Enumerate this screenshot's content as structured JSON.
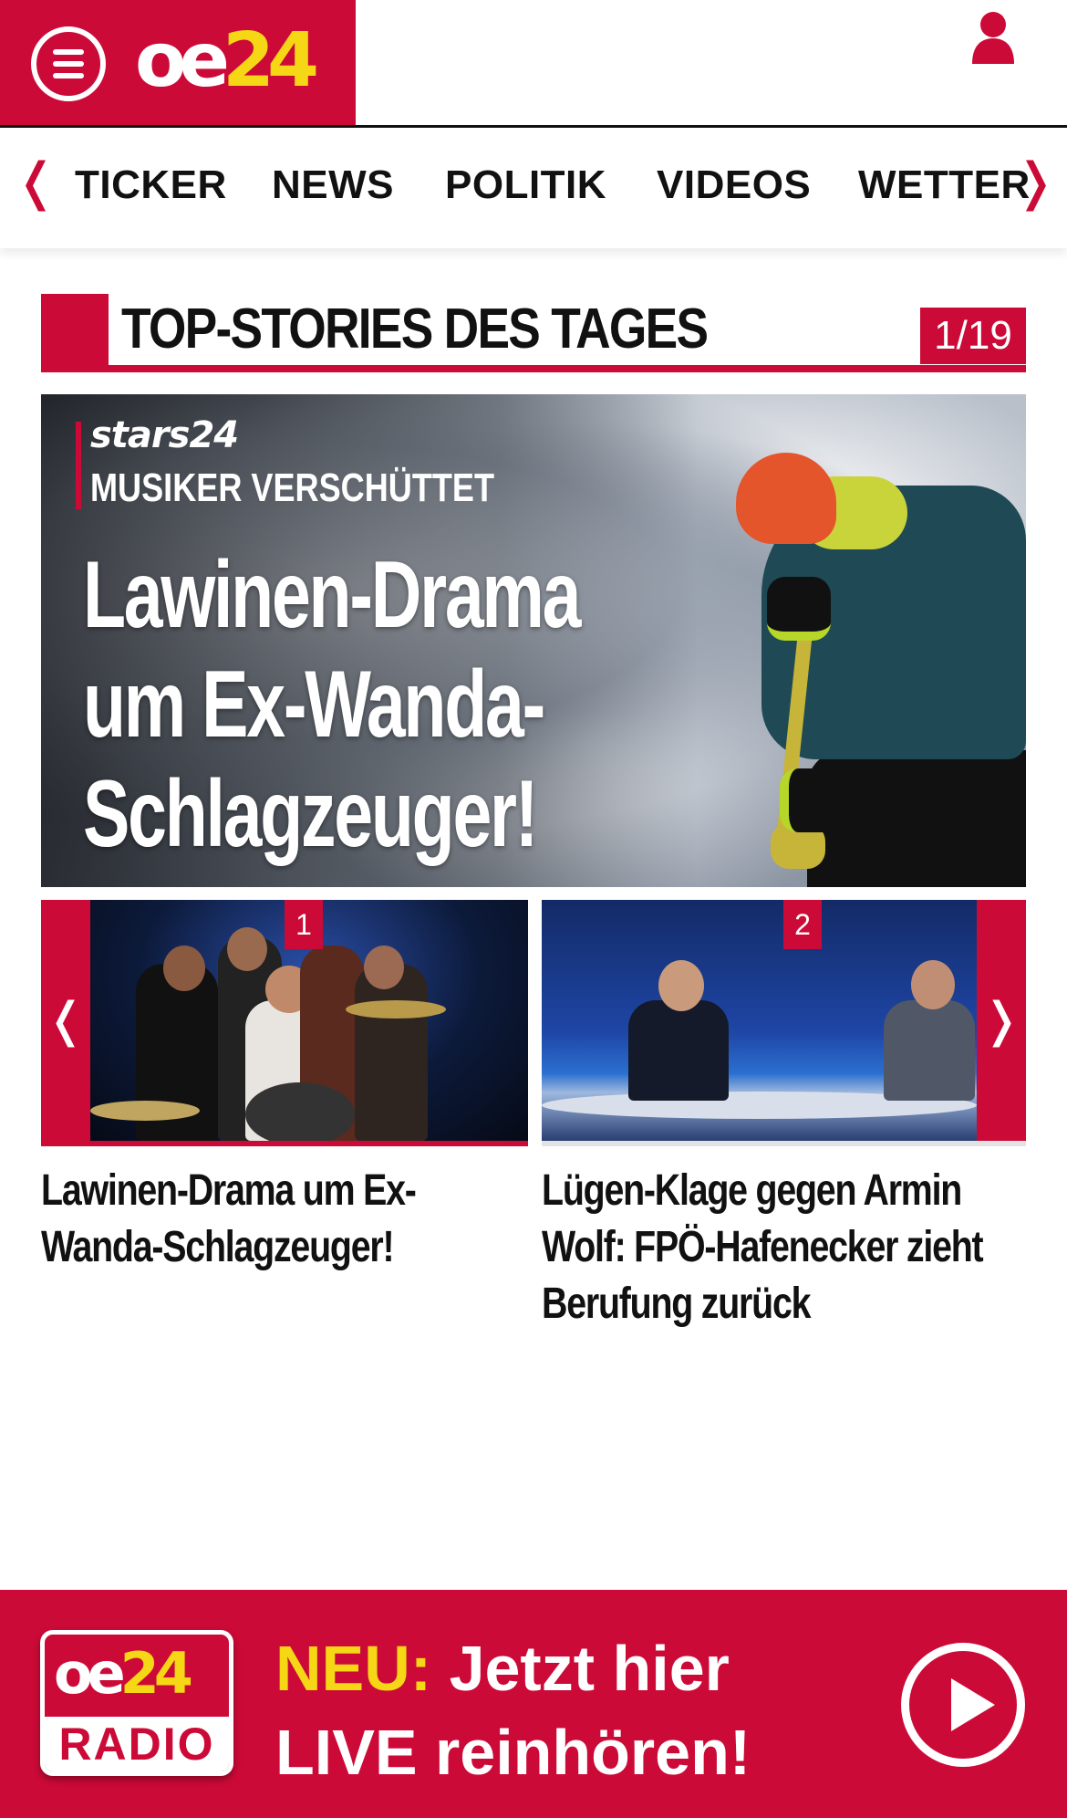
{
  "header": {
    "logo_oe": "oe",
    "logo_num": "24",
    "menu_icon": "hamburger-menu-icon",
    "user_icon": "user-icon"
  },
  "nav": {
    "prev_icon": "chevron-left-icon",
    "next_icon": "chevron-right-icon",
    "prev_glyph": "❬",
    "next_glyph": "❭",
    "items": [
      "TICKER",
      "NEWS",
      "POLITIK",
      "VIDEOS",
      "WETTER"
    ]
  },
  "section": {
    "title": "TOP-STORIES DES TAGES",
    "counter": "1/19"
  },
  "hero": {
    "brand": "stars24",
    "kicker": "MUSIKER VERSCHÜTTET",
    "headline_lines": [
      "Lawinen-Drama",
      "um Ex-Wanda-",
      "Schlagzeuger!"
    ]
  },
  "carousel": {
    "prev_glyph": "❬",
    "next_glyph": "❭",
    "items": [
      {
        "rank": "1",
        "title": "Lawinen-Drama um Ex-Wanda-Schlagzeuger!"
      },
      {
        "rank": "2",
        "title": "Lügen-Klage gegen Armin Wolf: FPÖ-Hafenecker zieht Berufung zurück"
      }
    ]
  },
  "radio": {
    "logo_oe": "oe",
    "logo_num": "24",
    "logo_label": "RADIO",
    "neu": "NEU:",
    "line1": "Jetzt hier",
    "line2": "LIVE reinhören!",
    "play_icon": "play-icon"
  },
  "colors": {
    "brand_red": "#cc0a37",
    "brand_yellow": "#f5d716"
  }
}
